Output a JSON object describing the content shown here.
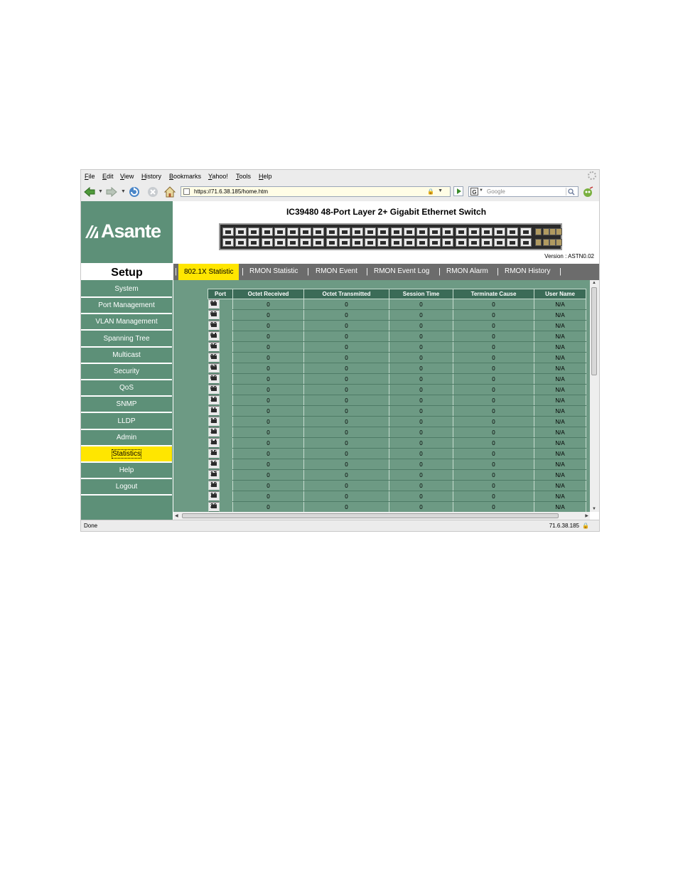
{
  "menu": [
    "File",
    "Edit",
    "View",
    "History",
    "Bookmarks",
    "Yahoo!",
    "Tools",
    "Help"
  ],
  "toolbar": {
    "url": "https://71.6.38.185/home.htm",
    "search_placeholder": "Google",
    "search_engine_icon": "G"
  },
  "logo": {
    "text": "Asante"
  },
  "header": {
    "title": "IC39480 48-Port Layer 2+ Gigabit Ethernet Switch",
    "version": "Version : ASTN0.02"
  },
  "sidebar": {
    "title": "Setup",
    "items": [
      "System",
      "Port Management",
      "VLAN Management",
      "Spanning Tree",
      "Multicast",
      "Security",
      "QoS",
      "SNMP",
      "LLDP",
      "Admin",
      "Statistics",
      "Help",
      "Logout"
    ],
    "active_index": 10
  },
  "tabs": [
    "802.1X Statistic",
    "RMON Statistic",
    "RMON Event",
    "RMON Event Log",
    "RMON Alarm",
    "RMON History"
  ],
  "active_tab": 0,
  "table": {
    "columns": [
      "Port",
      "Octet Received",
      "Octet Transmitted",
      "Session Time",
      "Terminate Cause",
      "User Name"
    ],
    "rows": [
      [
        "01",
        "0",
        "0",
        "0",
        "0",
        "N/A"
      ],
      [
        "02",
        "0",
        "0",
        "0",
        "0",
        "N/A"
      ],
      [
        "03",
        "0",
        "0",
        "0",
        "0",
        "N/A"
      ],
      [
        "04",
        "0",
        "0",
        "0",
        "0",
        "N/A"
      ],
      [
        "05",
        "0",
        "0",
        "0",
        "0",
        "N/A"
      ],
      [
        "06",
        "0",
        "0",
        "0",
        "0",
        "N/A"
      ],
      [
        "07",
        "0",
        "0",
        "0",
        "0",
        "N/A"
      ],
      [
        "08",
        "0",
        "0",
        "0",
        "0",
        "N/A"
      ],
      [
        "09",
        "0",
        "0",
        "0",
        "0",
        "N/A"
      ],
      [
        "10",
        "0",
        "0",
        "0",
        "0",
        "N/A"
      ],
      [
        "11",
        "0",
        "0",
        "0",
        "0",
        "N/A"
      ],
      [
        "12",
        "0",
        "0",
        "0",
        "0",
        "N/A"
      ],
      [
        "13",
        "0",
        "0",
        "0",
        "0",
        "N/A"
      ],
      [
        "14",
        "0",
        "0",
        "0",
        "0",
        "N/A"
      ],
      [
        "15",
        "0",
        "0",
        "0",
        "0",
        "N/A"
      ],
      [
        "16",
        "0",
        "0",
        "0",
        "0",
        "N/A"
      ],
      [
        "17",
        "0",
        "0",
        "0",
        "0",
        "N/A"
      ],
      [
        "18",
        "0",
        "0",
        "0",
        "0",
        "N/A"
      ],
      [
        "19",
        "0",
        "0",
        "0",
        "0",
        "N/A"
      ],
      [
        "20",
        "0",
        "0",
        "0",
        "0",
        "N/A"
      ]
    ]
  },
  "status": {
    "text": "Done",
    "host": "71.6.38.185"
  },
  "colors": {
    "sidebar_green": "#5d9078",
    "table_green": "#6d9a84",
    "header_green": "#3b6b57",
    "highlight_yellow": "#ffe600",
    "tabbar_gray": "#6c6c6c"
  }
}
